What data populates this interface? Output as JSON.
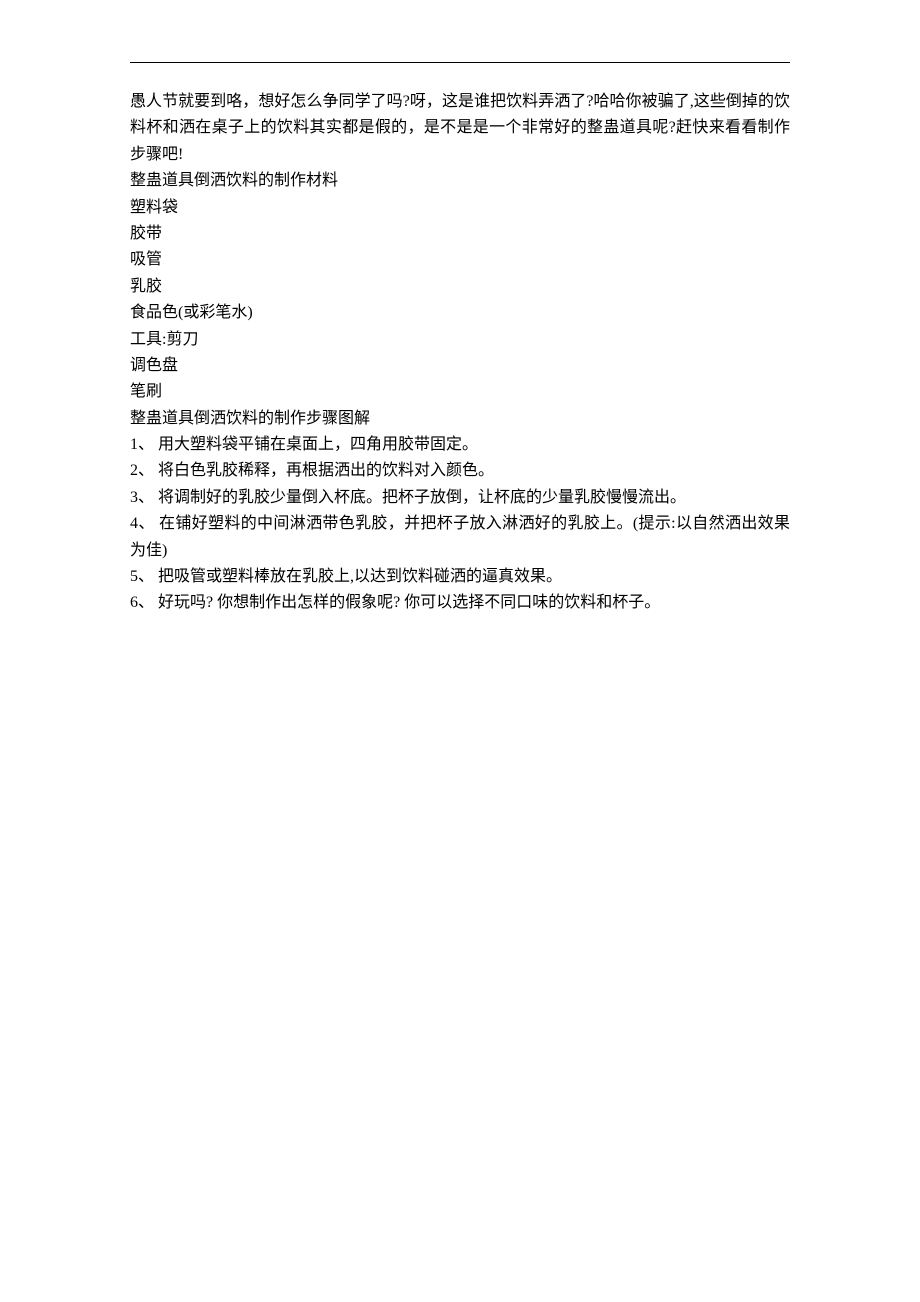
{
  "intro": "愚人节就要到咯，想好怎么争同学了吗?呀，这是谁把饮料弄洒了?哈哈你被骗了,这些倒掉的饮料杯和洒在桌子上的饮料其实都是假的，是不是是一个非常好的整蛊道具呢?赶快来看看制作步骤吧!",
  "materialsHeading": "整蛊道具倒洒饮料的制作材料",
  "materials": [
    "塑料袋",
    "胶带",
    "吸管",
    "乳胶",
    "食品色(或彩笔水)",
    "工具:剪刀",
    "调色盘",
    "笔刷"
  ],
  "stepsHeading": "整蛊道具倒洒饮料的制作步骤图解",
  "steps": [
    "1、 用大塑料袋平铺在桌面上，四角用胶带固定。",
    "2、 将白色乳胶稀释，再根据洒出的饮料对入颜色。",
    "3、 将调制好的乳胶少量倒入杯底。把杯子放倒，让杯底的少量乳胶慢慢流出。",
    "4、 在铺好塑料的中间淋洒带色乳胶，并把杯子放入淋洒好的乳胶上。(提示:以自然洒出效果为佳)",
    "5、 把吸管或塑料棒放在乳胶上,以达到饮料碰洒的逼真效果。",
    "6、 好玩吗? 你想制作出怎样的假象呢? 你可以选择不同口味的饮料和杯子。"
  ]
}
